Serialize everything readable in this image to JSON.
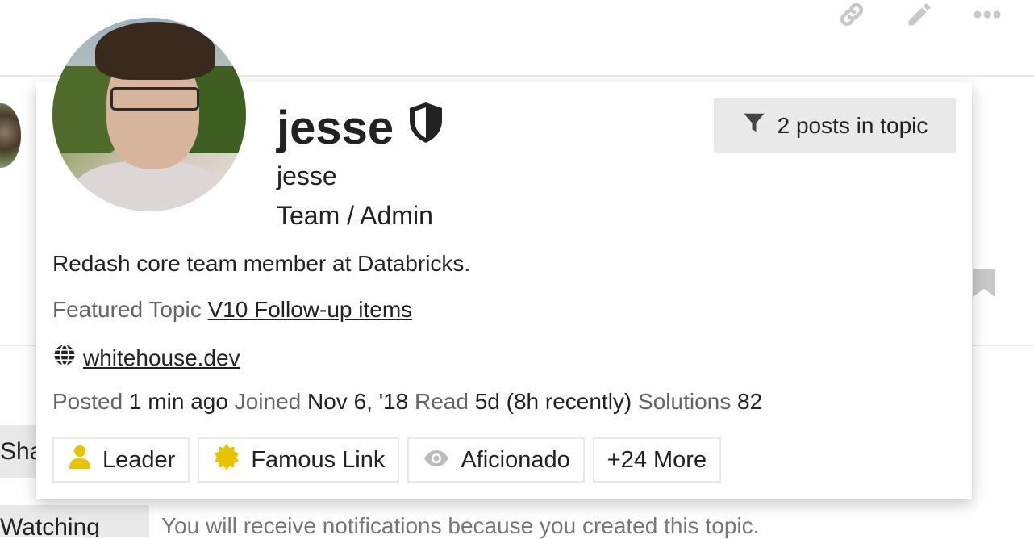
{
  "top_actions": [
    {
      "name": "link-icon"
    },
    {
      "name": "pencil-icon"
    },
    {
      "name": "more-icon"
    }
  ],
  "background": {
    "share_label": "Share",
    "watching_label": "Watching",
    "notification_text": "You will receive notifications because you created this topic."
  },
  "user_card": {
    "username": "jesse",
    "moderator_icon": "shield-icon",
    "name": "jesse",
    "title": "Team / Admin",
    "filter_button": {
      "icon": "filter-icon",
      "label": "2 posts in topic"
    },
    "bio": "Redash core team member at Databricks.",
    "featured_topic": {
      "label": "Featured Topic",
      "link": "V10 Follow-up items"
    },
    "website": {
      "icon": "globe-icon",
      "link": "whitehouse.dev"
    },
    "meta": {
      "posted_label": "Posted",
      "posted_value": "1 min ago",
      "joined_label": "Joined",
      "joined_value": "Nov 6, '18",
      "read_label": "Read",
      "read_value": "5d (8h recently)",
      "solutions_label": "Solutions",
      "solutions_value": "82"
    },
    "badges": [
      {
        "icon": "user-icon",
        "label": "Leader",
        "color": "#e7c300"
      },
      {
        "icon": "certificate-icon",
        "label": "Famous Link",
        "color": "#e7c300"
      },
      {
        "icon": "eye-icon",
        "label": "Aficionado",
        "color": "#bbbbbb"
      }
    ],
    "more_badges": "+24 More"
  },
  "colors": {
    "muted": "#646464",
    "badge_border": "#e9e9e9",
    "button_bg": "#e9e9e9",
    "text": "#222222"
  }
}
